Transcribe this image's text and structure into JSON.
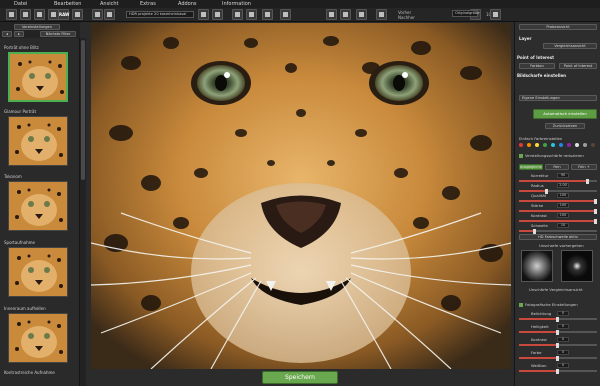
{
  "menubar": {
    "items": [
      "Datei",
      "Bearbeiten",
      "Ansicht",
      "Extras",
      "Addons",
      "Information"
    ]
  },
  "toolbar": {
    "raw_label": "RAW",
    "preset_value": "HDR projekte 20 kosmheinkasal",
    "labels": [
      "Vorher",
      "Nachher"
    ],
    "zoom_value": "Originalgröße",
    "zoom_suffix": "100 %"
  },
  "left_panel": {
    "header_button": "Voreinstellungen",
    "filter_button": "Nächste Filter",
    "presets": [
      {
        "label": "Porträt ohne Blitz",
        "selected": true
      },
      {
        "label": "Glamour Porträt",
        "selected": false
      },
      {
        "label": "Tokonom",
        "selected": false
      },
      {
        "label": "Sportaufnahme",
        "selected": false
      },
      {
        "label": "Innenraum aufhellen",
        "selected": false
      },
      {
        "label": "Kontrastreiche Aufnahme",
        "selected": false
      }
    ]
  },
  "main": {
    "save_label": "Speichern"
  },
  "right_panel": {
    "top_button": "Probeansicht",
    "layers_label": "Layer",
    "layer_button": "Vergleichsansicht",
    "poi_title": "Point of Interest",
    "poi_buttons": [
      "Farbton",
      "Point of Interest"
    ],
    "scene_title": "Bildscharfe einstellen",
    "scene_select": "Eigene Einstellungen",
    "auto_button": "Automatisch einstellen",
    "reset_button": "Zurücksetzen",
    "colors_label": "Einfach Farbreinstellen",
    "swatch_colors": [
      "#e53935",
      "#fb8c00",
      "#fdd835",
      "#43a047",
      "#26c6da",
      "#1e88e5",
      "#8e24aa",
      "#e0e0e0",
      "#9e9e9e",
      "#5d4037"
    ],
    "sharpen_label": "Verstellungsschärfe reduzieren",
    "mode_buttons": [
      "Ausgeglichen",
      "Fein",
      "Fein +"
    ],
    "sliders_a": [
      {
        "label": "Korrektur",
        "value": "90",
        "fraction": 0.9
      },
      {
        "label": "Radius",
        "value": "2.00",
        "fraction": 0.35
      },
      {
        "label": "Qualität",
        "value": "100",
        "fraction": 1.0
      },
      {
        "label": "Stärke",
        "value": "100",
        "fraction": 1.0
      },
      {
        "label": "Kontrast",
        "value": "100",
        "fraction": 1.0
      },
      {
        "label": "Schwelle",
        "value": "10",
        "fraction": 0.2
      }
    ],
    "hdr_button": "HD Farbschwelle aktiv",
    "preview_label": "Unscharfe vorhergehen",
    "compare_label": "Unschärfe Vergleichsansicht",
    "photo_title": "Fotografische Einstellungen",
    "sliders_b": [
      {
        "label": "Belichtung",
        "value": "0",
        "fraction": 0.5
      },
      {
        "label": "Helligkeit",
        "value": "0",
        "fraction": 0.5
      },
      {
        "label": "Kontrast",
        "value": "0",
        "fraction": 0.5
      },
      {
        "label": "Farbe",
        "value": "0",
        "fraction": 0.5
      },
      {
        "label": "Weißton",
        "value": "0",
        "fraction": 0.5
      }
    ]
  }
}
